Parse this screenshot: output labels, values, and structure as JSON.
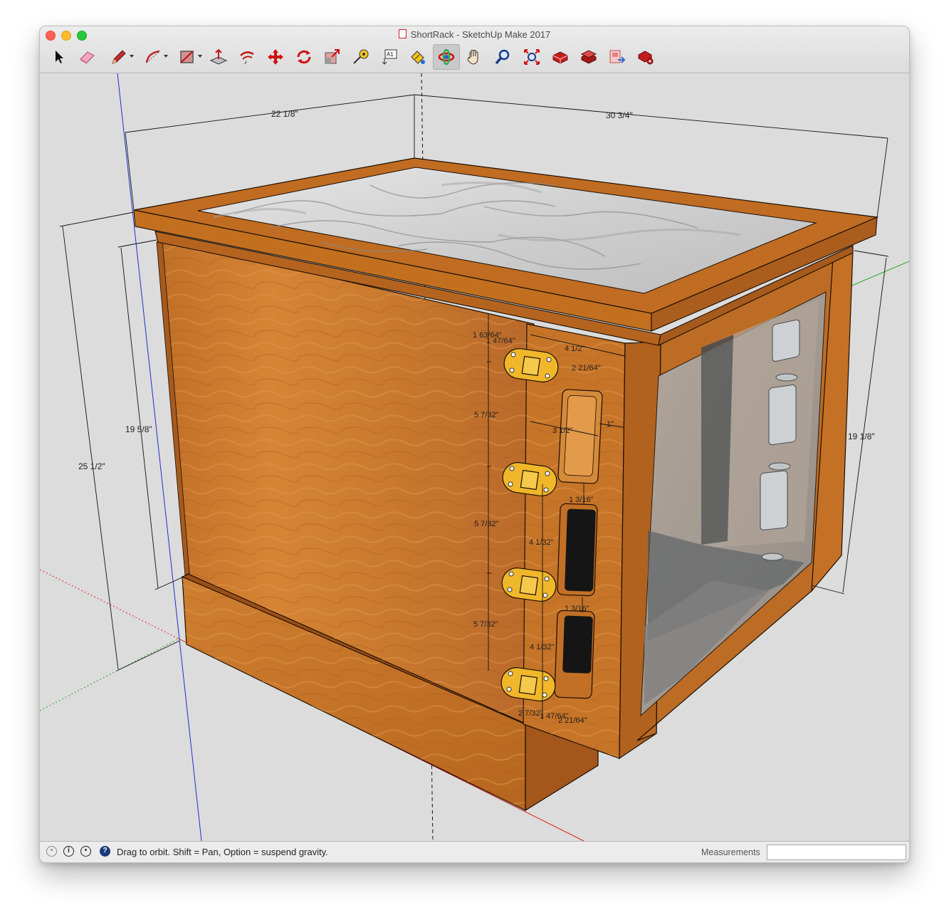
{
  "window": {
    "title": "ShortRack - SketchUp Make 2017"
  },
  "toolbar": {
    "tools": [
      {
        "name": "select-tool",
        "icon": "arrow-cursor-icon"
      },
      {
        "name": "eraser-tool",
        "icon": "eraser-icon"
      },
      {
        "name": "line-tool",
        "icon": "pencil-icon",
        "dropdown": true
      },
      {
        "name": "arc-tool",
        "icon": "arc-icon",
        "dropdown": true
      },
      {
        "name": "rectangle-tool",
        "icon": "rectangle-icon",
        "dropdown": true
      },
      {
        "name": "push-pull-tool",
        "icon": "push-pull-icon"
      },
      {
        "name": "offset-tool",
        "icon": "offset-icon"
      },
      {
        "name": "move-tool",
        "icon": "move-arrows-icon"
      },
      {
        "name": "rotate-tool",
        "icon": "rotate-icon"
      },
      {
        "name": "scale-tool",
        "icon": "scale-icon"
      },
      {
        "name": "tape-measure-tool",
        "icon": "tape-measure-icon"
      },
      {
        "name": "text-tool",
        "icon": "text-label-icon"
      },
      {
        "name": "paint-bucket-tool",
        "icon": "paint-bucket-icon"
      },
      {
        "name": "orbit-tool",
        "icon": "orbit-icon",
        "active": true
      },
      {
        "name": "pan-tool",
        "icon": "hand-icon"
      },
      {
        "name": "zoom-tool",
        "icon": "magnifier-icon"
      },
      {
        "name": "zoom-extents-tool",
        "icon": "zoom-extents-icon"
      },
      {
        "name": "warehouse-tool",
        "icon": "3d-warehouse-icon"
      },
      {
        "name": "extension-warehouse-tool",
        "icon": "extension-warehouse-icon"
      },
      {
        "name": "send-to-layout-tool",
        "icon": "send-to-layout-icon"
      },
      {
        "name": "extension-manager-tool",
        "icon": "extension-manager-icon"
      }
    ],
    "text_tool_glyph": "A1"
  },
  "dimensions": {
    "top_left_width": "22 1/8\"",
    "top_right_depth": "30 3/4\"",
    "overall_height": "25 1/2\"",
    "side_panel_height": "19 5/8\"",
    "door_height": "19 1/8\"",
    "hinge_top_offset": "1 63/64\"",
    "hinge_top_inner": "1 47/64\"",
    "hinge_plate_width": "4 1/2\"",
    "vent_edge_offset": "2 21/64\"",
    "vent_width": "3 1/2\"",
    "vent_margin": "1\"",
    "hinge_spacing_1": "5 7/32\"",
    "hinge_spacing_2": "5 7/32\"",
    "hinge_spacing_3": "5 7/32\"",
    "vent_gap_1": "1 3/16\"",
    "vent_gap_2": "1 3/16\"",
    "vent_height_1": "4 1/32\"",
    "vent_height_2": "4 1/32\"",
    "hinge_bottom_offset": "2 7/32\"",
    "hinge_bottom_inner": "1 47/64\"",
    "vent_bottom_offset": "2 21/64\""
  },
  "colors": {
    "axis_red": "#d42020",
    "axis_green": "#22aa22",
    "axis_blue": "#2030c8",
    "wood": "#c9772c",
    "wood_dark": "#9c5418",
    "marble": "#d6d6d6",
    "hinge": "#f0b72a"
  },
  "status": {
    "hint": "Drag to orbit. Shift = Pan, Option = suspend gravity.",
    "measurements_label": "Measurements",
    "measurements_value": ""
  }
}
